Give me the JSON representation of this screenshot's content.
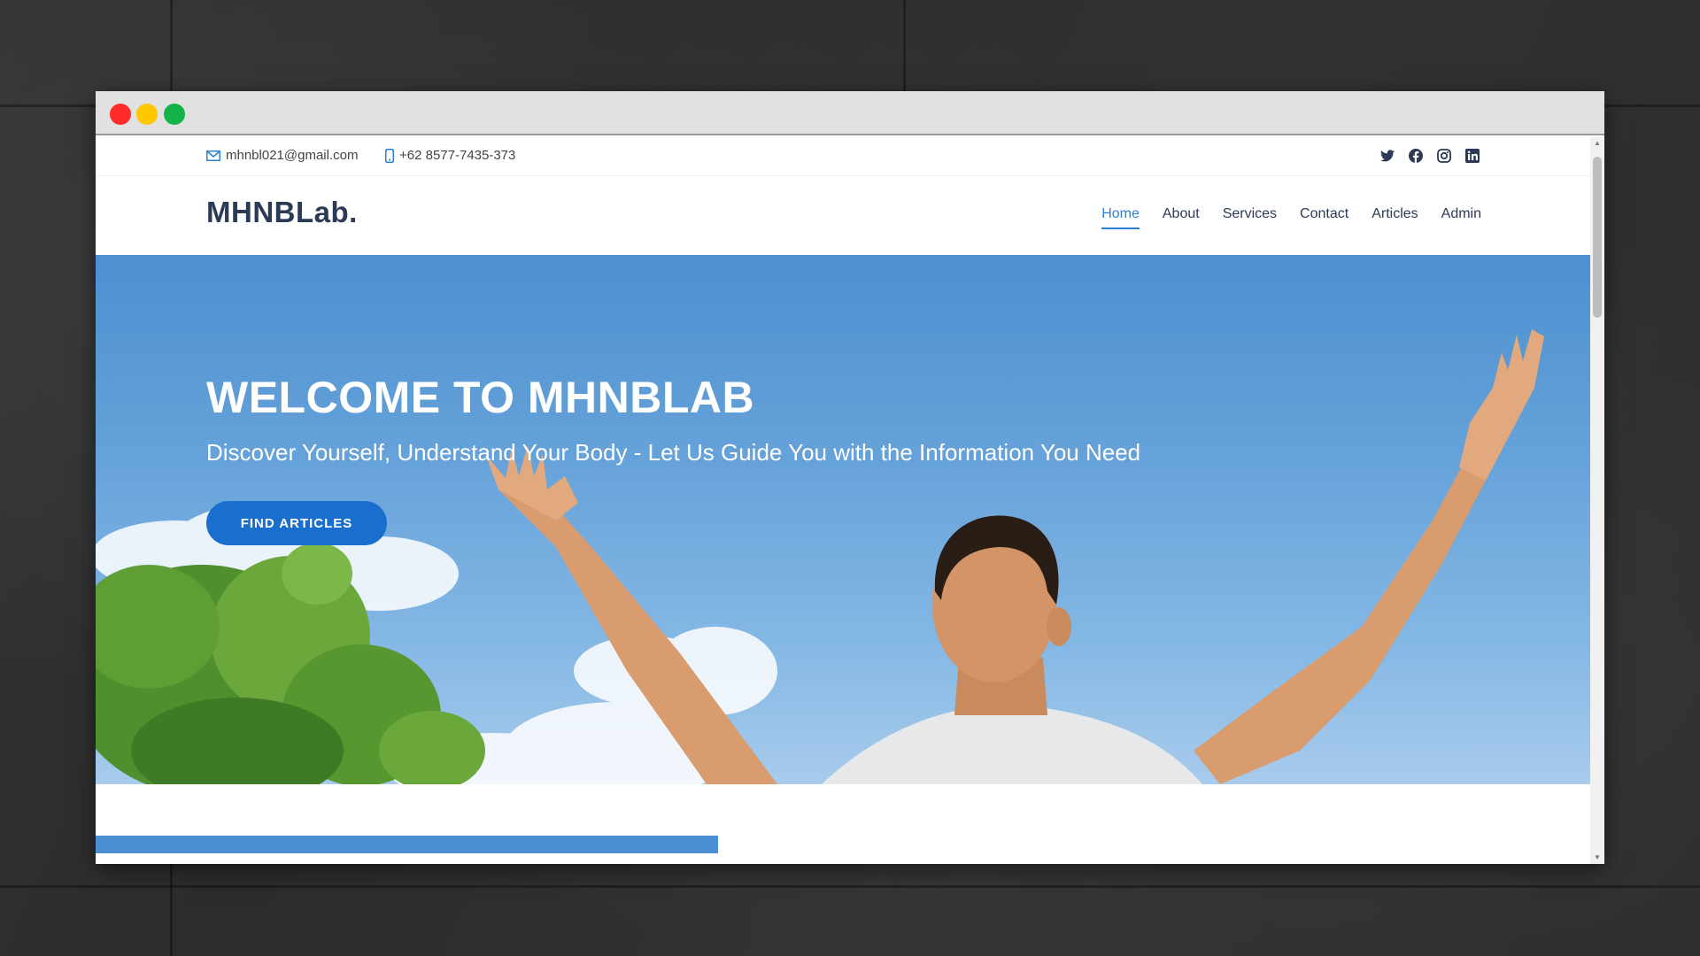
{
  "window": {
    "controls": [
      "close",
      "minimize",
      "maximize"
    ]
  },
  "topbar": {
    "email": "mhnbl021@gmail.com",
    "phone": "+62 8577-7435-373",
    "socials": [
      "twitter-icon",
      "facebook-icon",
      "instagram-icon",
      "linkedin-icon"
    ]
  },
  "header": {
    "logo": "MHNBLab.",
    "nav": [
      {
        "label": "Home",
        "active": true
      },
      {
        "label": "About",
        "active": false
      },
      {
        "label": "Services",
        "active": false
      },
      {
        "label": "Contact",
        "active": false
      },
      {
        "label": "Articles",
        "active": false
      },
      {
        "label": "Admin",
        "active": false
      }
    ]
  },
  "hero": {
    "title": "WELCOME TO MHNBLAB",
    "subtitle": "Discover Yourself, Understand Your Body - Let Us Guide You with the Information You Need",
    "button": "FIND ARTICLES"
  },
  "colors": {
    "accent": "#2d7fd0",
    "button": "#1a6fce",
    "logo": "#2b3a55",
    "sky": "#5b9bd8"
  }
}
